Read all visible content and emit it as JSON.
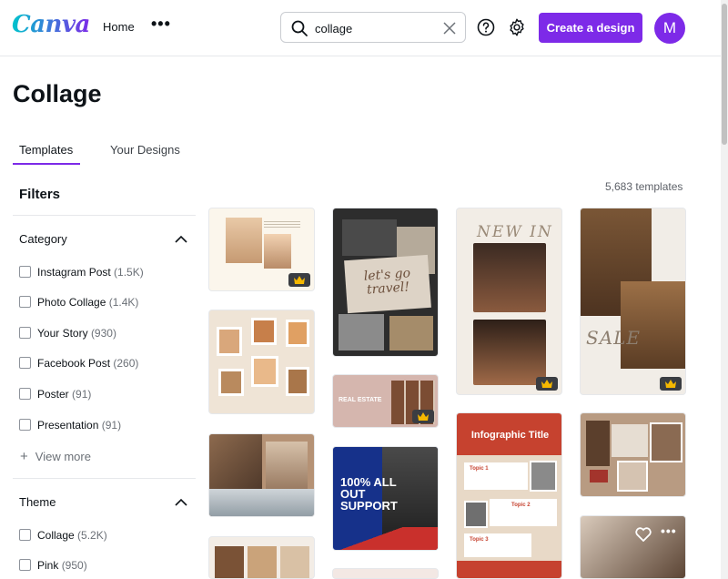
{
  "header": {
    "logo": "Canva",
    "nav_home": "Home",
    "more_label": "•••",
    "search": {
      "value": "collage",
      "placeholder": "Search"
    },
    "create_button": "Create a design",
    "avatar_initial": "M"
  },
  "page": {
    "title": "Collage",
    "tabs": [
      {
        "label": "Templates",
        "active": true
      },
      {
        "label": "Your Designs",
        "active": false
      }
    ],
    "template_count": "5,683 templates"
  },
  "filters": {
    "title": "Filters",
    "category": {
      "title": "Category",
      "options": [
        {
          "label": "Instagram Post",
          "count": "(1.5K)"
        },
        {
          "label": "Photo Collage",
          "count": "(1.4K)"
        },
        {
          "label": "Your Story",
          "count": "(930)"
        },
        {
          "label": "Facebook Post",
          "count": "(260)"
        },
        {
          "label": "Poster",
          "count": "(91)"
        },
        {
          "label": "Presentation",
          "count": "(91)"
        }
      ],
      "view_more": "View more"
    },
    "theme": {
      "title": "Theme",
      "options": [
        {
          "label": "Collage",
          "count": "(5.2K)"
        },
        {
          "label": "Pink",
          "count": "(950)"
        }
      ]
    }
  },
  "templates": {
    "travel_text": "let's go travel!",
    "real_estate_text": "REAL ESTATE",
    "support_text": "100% ALL OUT SUPPORT",
    "infographic_title": "Infographic Title",
    "new_in_text": "NEW IN",
    "sale_text": "SALE",
    "topic_labels": [
      "Topic 1",
      "Topic 2",
      "Topic 3"
    ]
  },
  "colors": {
    "accent": "#7d2ae8",
    "logo_teal": "#00c4cc"
  }
}
